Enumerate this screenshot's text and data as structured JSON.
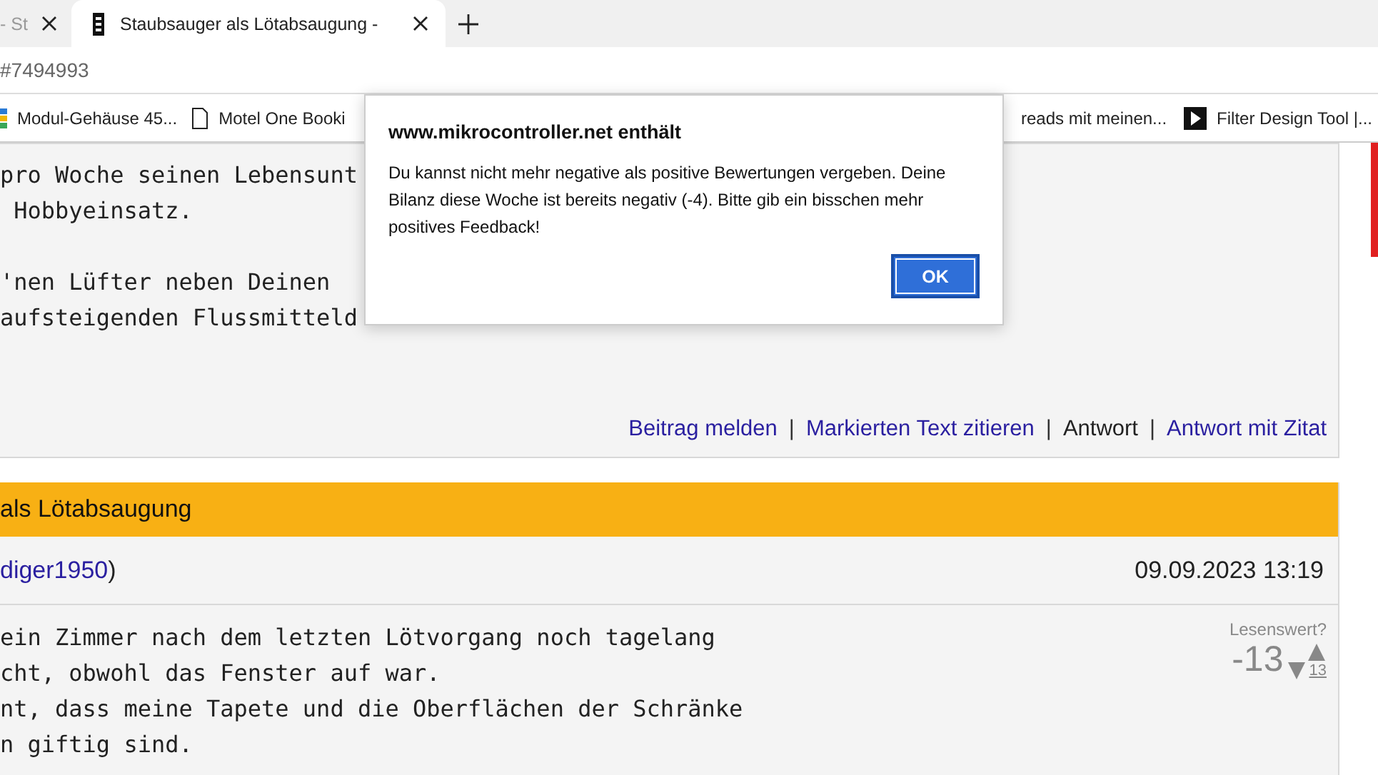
{
  "tabs": [
    {
      "title": "- St",
      "selected": false
    },
    {
      "title": "Staubsauger als Lötabsaugung -",
      "selected": true
    }
  ],
  "address": "#7494993",
  "bookmarks": [
    {
      "label": "Modul-Gehäuse 45...",
      "kind": "page"
    },
    {
      "label": "Motel One Booki",
      "kind": "doc"
    },
    {
      "label": "reads mit meinen...",
      "kind": "none"
    },
    {
      "label": "Filter Design Tool |...",
      "kind": "play"
    }
  ],
  "post1": {
    "paragraphs": [
      [
        "pro Woche seinen Lebensunt",
        " Hobbyeinsatz."
      ],
      [
        "'nen Lüfter neben Deinen",
        "aufsteigenden Flussmitteld"
      ]
    ],
    "separator": "|",
    "actions": [
      {
        "label": "Beitrag melden",
        "link": true
      },
      {
        "label": "Markierten Text zitieren",
        "link": true
      },
      {
        "label": "Antwort",
        "link": false
      },
      {
        "label": "Antwort mit Zitat",
        "link": true
      }
    ]
  },
  "post2": {
    "subject": "als Lötabsaugung",
    "author": "diger1950",
    "author_suffix": ")",
    "date": "09.09.2023 13:19",
    "lines": [
      "ein Zimmer nach dem letzten Lötvorgang noch tagelang",
      "cht, obwohl das Fenster auf war.",
      "nt, dass meine Tapete und die Oberflächen der Schränke",
      "n giftig sind."
    ],
    "rating": {
      "label": "Lesenswert?",
      "score": "-13",
      "down_count": "13"
    }
  },
  "dialog": {
    "title": "www.mikrocontroller.net enthält",
    "message": "Du kannst nicht mehr negative als positive Bewertungen vergeben. Deine Bilanz diese Woche ist bereits negativ (-4). Bitte gib ein bisschen mehr positives Feedback!",
    "button": "OK"
  }
}
